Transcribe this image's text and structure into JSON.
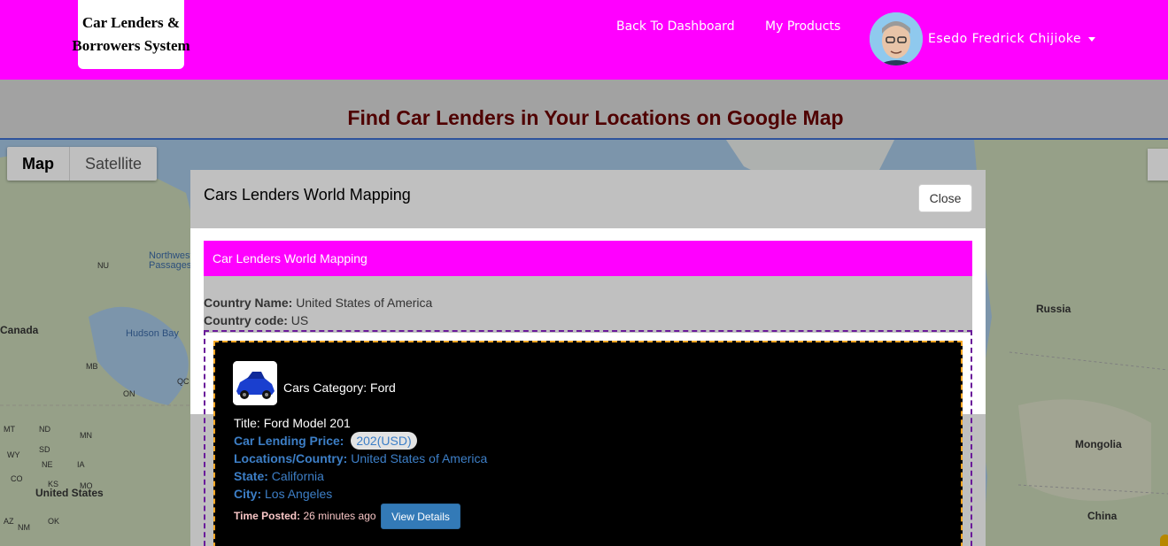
{
  "navbar": {
    "logo_line1": "Car Lenders &",
    "logo_line2": "Borrowers System",
    "links": [
      "Back To Dashboard",
      "My Products"
    ],
    "user_name": "Esedo Fredrick Chijioke",
    "bg_color": "#ff00ff"
  },
  "page": {
    "title": "Find Car Lenders in Your Locations on Google Map"
  },
  "map": {
    "type_buttons": [
      "Map",
      "Satellite"
    ],
    "labels": [
      "Canada",
      "Hudson Bay",
      "Northwest Passages",
      "NU",
      "MB",
      "ON",
      "QC",
      "MT",
      "ND",
      "MN",
      "SD",
      "WY",
      "NE",
      "IA",
      "CO",
      "KS",
      "MO",
      "AZ",
      "NM",
      "OK",
      "United States",
      "Russia",
      "Mongolia",
      "China"
    ]
  },
  "modal": {
    "title": "Cars Lenders World Mapping",
    "close_label": "Close",
    "panel_heading": "Car Lenders World Mapping",
    "country_name_label": "Country Name:",
    "country_name": "United States of America",
    "country_code_label": "Country code:",
    "country_code": "US"
  },
  "listing": {
    "category_label": "Cars Category:",
    "category": "Ford",
    "title_label": "Title:",
    "title": "Ford Model 201",
    "price_label": "Car Lending Price:",
    "price": "202(USD)",
    "location_label": "Locations/Country:",
    "location": "United States of America",
    "state_label": "State:",
    "state": "California",
    "city_label": "City:",
    "city": "Los Angeles",
    "time_label": "Time Posted:",
    "time": "26 minutes ago",
    "view_label": "View Details"
  }
}
